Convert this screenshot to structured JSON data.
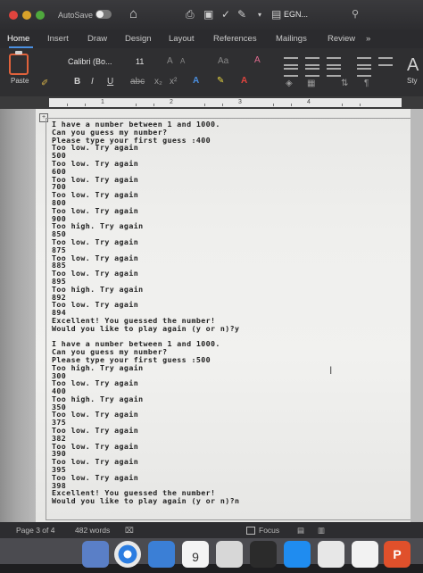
{
  "titlebar": {
    "autosave_label": "AutoSave",
    "doc_title": "EGN...",
    "toolbar_icons": [
      "home-icon",
      "print-icon",
      "save-icon",
      "check-icon",
      "edit-icon"
    ]
  },
  "ribbon_tabs": [
    "Home",
    "Insert",
    "Draw",
    "Design",
    "Layout",
    "References",
    "Mailings",
    "Review"
  ],
  "ribbon": {
    "paste_label": "Paste",
    "font_name": "Calibri (Bo...",
    "font_size": "11",
    "bold": "B",
    "italic": "I",
    "underline": "U",
    "styles_label": "Sty"
  },
  "ruler": {
    "numbers": [
      "1",
      "2",
      "3",
      "4"
    ]
  },
  "document": {
    "console_lines": [
      "I have a number between 1 and 1000.",
      "Can you guess my number?",
      "Please type your first guess :400",
      "Too low. Try again",
      "500",
      "Too low. Try again",
      "600",
      "Too low. Try again",
      "700",
      "Too low. Try again",
      "800",
      "Too low. Try again",
      "900",
      "Too high. Try again",
      "850",
      "Too low. Try again",
      "875",
      "Too low. Try again",
      "885",
      "Too low. Try again",
      "895",
      "Too high. Try again",
      "892",
      "Too low. Try again",
      "894",
      "Excellent! You guessed the number!",
      "Would you like to play again (y or n)?y",
      "",
      "I have a number between 1 and 1000.",
      "Can you guess my number?",
      "Please type your first guess :500",
      "Too high. Try again",
      "300",
      "Too low. Try again",
      "400",
      "Too high. Try again",
      "350",
      "Too low. Try again",
      "375",
      "Too low. Try again",
      "382",
      "Too low. Try again",
      "390",
      "Too low. Try again",
      "395",
      "Too low. Try again",
      "398",
      "Excellent! You guessed the number!",
      "Would you like to play again (y or n)?n"
    ]
  },
  "statusbar": {
    "page_info": "Page 3 of 4",
    "word_count": "482 words",
    "focus_label": "Focus"
  },
  "dock": {
    "calendar_day": "9"
  },
  "colors": {
    "accent": "#4a8fe0",
    "titlebar": "#2c2c2f",
    "page": "#f0f0ee"
  }
}
